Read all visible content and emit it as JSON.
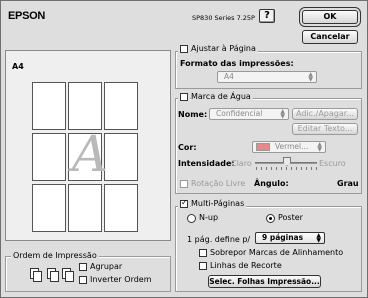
{
  "header": {
    "brand": "EPSON",
    "model": "SP830 Series 7.25P",
    "help_label": "?",
    "ok_label": "OK",
    "cancel_label": "Cancelar"
  },
  "preview": {
    "paper_label": "A4",
    "watermark_letter": "A"
  },
  "fit_to_page": {
    "title": "Ajustar à Página",
    "checked": false,
    "format_label": "Formato das impressões:",
    "format_value": "A4"
  },
  "watermark": {
    "title": "Marca de Água",
    "checked": false,
    "name_label": "Nome:",
    "name_value": "Confidencial",
    "add_remove_label": "Adic./Apagar...",
    "edit_text_label": "Editar Texto...",
    "color_label": "Cor:",
    "color_value": "Vermel...",
    "color_hex": "#e58a8a",
    "intensity_label": "Intensidade:",
    "intensity_light": "Claro",
    "intensity_dark": "Escuro",
    "free_rotation_label": "Rotação Livre",
    "angle_label": "Ângulo:",
    "angle_unit": "Grau"
  },
  "multi_page": {
    "title": "Multi-Páginas",
    "checked": true,
    "nup_label": "N-up",
    "poster_label": "Poster",
    "selected_mode": "Poster",
    "page_defines_label": "1 pág. define p/",
    "page_count_value": "9 páginas",
    "overlay_marks_label": "Sobrepor Marcas de Alinhamento",
    "cut_lines_label": "Linhas de Recorte",
    "select_sheets_label": "Selec. Folhas Impressão..."
  },
  "print_order": {
    "title": "Ordem de Impressão",
    "collate_label": "Agrupar",
    "reverse_label": "Inverter Ordem"
  }
}
